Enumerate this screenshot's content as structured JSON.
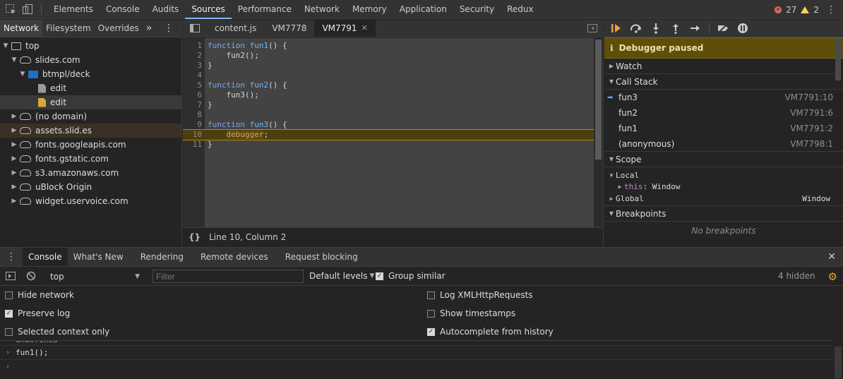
{
  "topbar": {
    "tabs": [
      "Elements",
      "Console",
      "Audits",
      "Sources",
      "Performance",
      "Network",
      "Memory",
      "Application",
      "Security",
      "Redux"
    ],
    "active_tab": "Sources",
    "errors": "27",
    "warnings": "2"
  },
  "navigator": {
    "tabs": [
      "Network",
      "Filesystem",
      "Overrides"
    ],
    "more": "»",
    "tree": [
      {
        "label": "top",
        "depth": 0,
        "icon": "frame-icon",
        "expanded": true
      },
      {
        "label": "slides.com",
        "depth": 1,
        "icon": "cloud-icon",
        "expanded": true
      },
      {
        "label": "btmpl/deck",
        "depth": 2,
        "icon": "folder-icon",
        "expanded": true
      },
      {
        "label": "edit",
        "depth": 3,
        "icon": "file-icon"
      },
      {
        "label": "edit",
        "depth": 3,
        "icon": "file-js-icon"
      },
      {
        "label": "(no domain)",
        "depth": 1,
        "icon": "cloud-icon",
        "expanded": false
      },
      {
        "label": "assets.slid.es",
        "depth": 1,
        "icon": "cloud-icon",
        "expanded": false
      },
      {
        "label": "fonts.googleapis.com",
        "depth": 1,
        "icon": "cloud-icon",
        "expanded": false
      },
      {
        "label": "fonts.gstatic.com",
        "depth": 1,
        "icon": "cloud-icon",
        "expanded": false
      },
      {
        "label": "s3.amazonaws.com",
        "depth": 1,
        "icon": "cloud-icon",
        "expanded": false
      },
      {
        "label": "uBlock Origin",
        "depth": 1,
        "icon": "cloud-icon",
        "expanded": false
      },
      {
        "label": "widget.uservoice.com",
        "depth": 1,
        "icon": "cloud-icon",
        "expanded": false
      }
    ]
  },
  "editor": {
    "tabs": [
      "content.js",
      "VM7778",
      "VM7791"
    ],
    "active_tab": "VM7791",
    "lines": [
      {
        "n": "1",
        "code": "function fun1() {"
      },
      {
        "n": "2",
        "code": "    fun2();"
      },
      {
        "n": "3",
        "code": "}"
      },
      {
        "n": "4",
        "code": ""
      },
      {
        "n": "5",
        "code": "function fun2() {"
      },
      {
        "n": "6",
        "code": "    fun3();"
      },
      {
        "n": "7",
        "code": "}"
      },
      {
        "n": "8",
        "code": ""
      },
      {
        "n": "9",
        "code": "function fun3() {"
      },
      {
        "n": "10",
        "code": "    debugger;"
      },
      {
        "n": "11",
        "code": "}"
      }
    ],
    "current_line": "10",
    "status": "Line 10, Column 2",
    "format_icon": "{}"
  },
  "debugger": {
    "paused_label": "Debugger paused",
    "watch_label": "Watch",
    "callstack_label": "Call Stack",
    "stack": [
      {
        "fn": "fun3",
        "loc": "VM7791:10"
      },
      {
        "fn": "fun2",
        "loc": "VM7791:6"
      },
      {
        "fn": "fun1",
        "loc": "VM7791:2"
      },
      {
        "fn": "(anonymous)",
        "loc": "VM7798:1"
      }
    ],
    "scope_label": "Scope",
    "local_label": "Local",
    "this_key": "this",
    "this_value": ": Window",
    "global_label": "Global",
    "global_value": "Window",
    "breakpoints_label": "Breakpoints",
    "no_breakpoints": "No breakpoints"
  },
  "drawer": {
    "tabs": [
      "Console",
      "What's New",
      "Rendering",
      "Remote devices",
      "Request blocking"
    ],
    "active_tab": "Console",
    "context": "top",
    "filter_placeholder": "Filter",
    "levels": "Default levels",
    "group_similar": "Group similar",
    "hidden": "4 hidden",
    "options_left": [
      {
        "label": "Hide network",
        "checked": false
      },
      {
        "label": "Preserve log",
        "checked": true
      },
      {
        "label": "Selected context only",
        "checked": false
      }
    ],
    "options_right": [
      {
        "label": "Log XMLHttpRequests",
        "checked": false
      },
      {
        "label": "Show timestamps",
        "checked": false
      },
      {
        "label": "Autocomplete from history",
        "checked": true
      }
    ],
    "console_lines": [
      "undefined",
      "fun1();"
    ]
  }
}
